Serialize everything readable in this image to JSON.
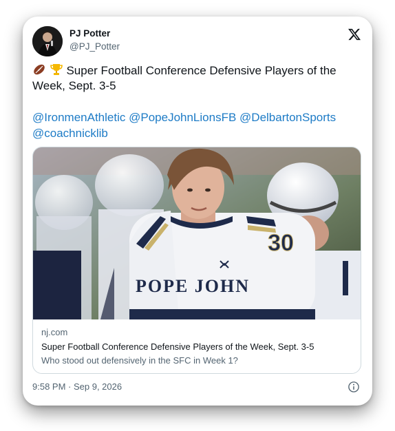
{
  "author": {
    "display_name": "PJ Potter",
    "handle": "@PJ_Potter"
  },
  "icons": {
    "platform": "x-logo-icon",
    "info": "info-icon",
    "emoji_1": "football-emoji",
    "emoji_2": "trophy-emoji"
  },
  "tweet": {
    "text": "Super Football Conference Defensive Players of the Week, Sept. 3-5",
    "mentions": [
      "@IronmenAthletic",
      "@PopeJohnLionsFB",
      "@DelbartonSports",
      "@coachnicklib"
    ]
  },
  "link_card": {
    "image_jersey_text": "POPE JOHN",
    "image_jersey_number": "30",
    "domain": "nj.com",
    "title": "Super Football Conference Defensive Players of the Week, Sept. 3-5",
    "description": "Who stood out defensively in the SFC in Week 1?"
  },
  "footer": {
    "timestamp": "9:58 PM · Sep 9, 2026"
  },
  "colors": {
    "text": "#0f1419",
    "secondary": "#536471",
    "link": "#1d7bc6",
    "border": "#cfd9de",
    "jersey_navy": "#1e2a4a",
    "jersey_gold": "#c9b26b"
  }
}
